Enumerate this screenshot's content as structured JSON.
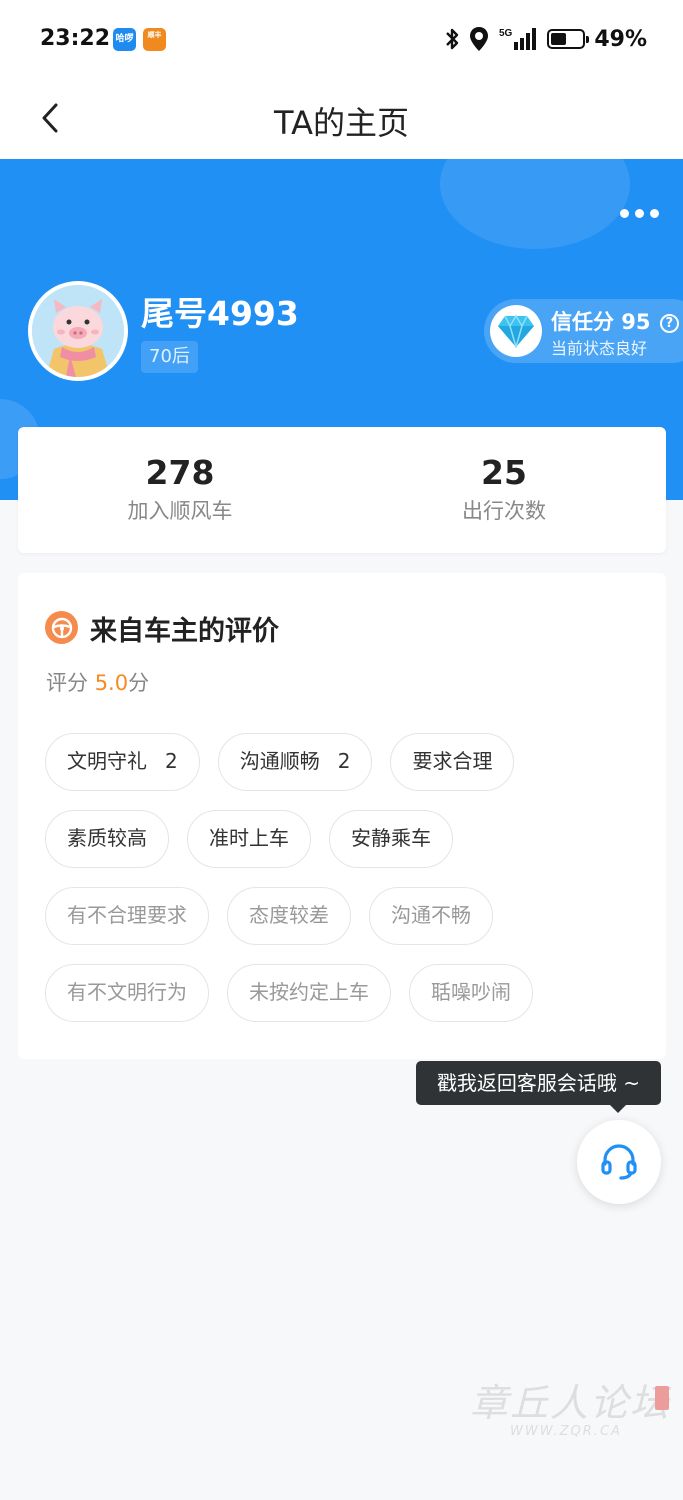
{
  "status_bar": {
    "time": "23:22",
    "app_icons": [
      "哈啰",
      "顺丰"
    ],
    "network": "5G",
    "battery": "49%",
    "battery_level": 0.49
  },
  "nav": {
    "back_icon": "chevron-left-icon",
    "title": "TA的主页"
  },
  "profile": {
    "name": "尾号4993",
    "age_tag": "70后",
    "trust": {
      "label": "信任分 95",
      "help_icon": "?",
      "status": "当前状态良好"
    }
  },
  "stats": [
    {
      "value": "278",
      "label": "加入顺风车"
    },
    {
      "value": "25",
      "label": "出行次数"
    }
  ],
  "reviews": {
    "title": "来自车主的评价",
    "rating_label": "评分",
    "rating_value": "5.0",
    "rating_unit": "分",
    "tag_rows": [
      [
        {
          "label": "文明守礼",
          "count": "2",
          "negative": false
        },
        {
          "label": "沟通顺畅",
          "count": "2",
          "negative": false
        },
        {
          "label": "要求合理",
          "count": "",
          "negative": false
        }
      ],
      [
        {
          "label": "素质较高",
          "count": "",
          "negative": false
        },
        {
          "label": "准时上车",
          "count": "",
          "negative": false
        },
        {
          "label": "安静乘车",
          "count": "",
          "negative": false
        }
      ],
      [
        {
          "label": "有不合理要求",
          "count": "",
          "negative": true
        },
        {
          "label": "态度较差",
          "count": "",
          "negative": true
        },
        {
          "label": "沟通不畅",
          "count": "",
          "negative": true
        }
      ],
      [
        {
          "label": "有不文明行为",
          "count": "",
          "negative": true
        },
        {
          "label": "未按约定上车",
          "count": "",
          "negative": true
        },
        {
          "label": "聒噪吵闹",
          "count": "",
          "negative": true
        }
      ]
    ]
  },
  "customer_service": {
    "tooltip": "戳我返回客服会话哦 ~",
    "icon": "headset-icon"
  },
  "watermark": {
    "text": "章丘人论坛",
    "url": "WWW.ZQR.CA"
  },
  "colors": {
    "brand_blue": "#2190f5",
    "rating_orange": "#f58b22",
    "review_icon_orange": "#f58b4c",
    "tooltip_bg": "#2f3336"
  }
}
